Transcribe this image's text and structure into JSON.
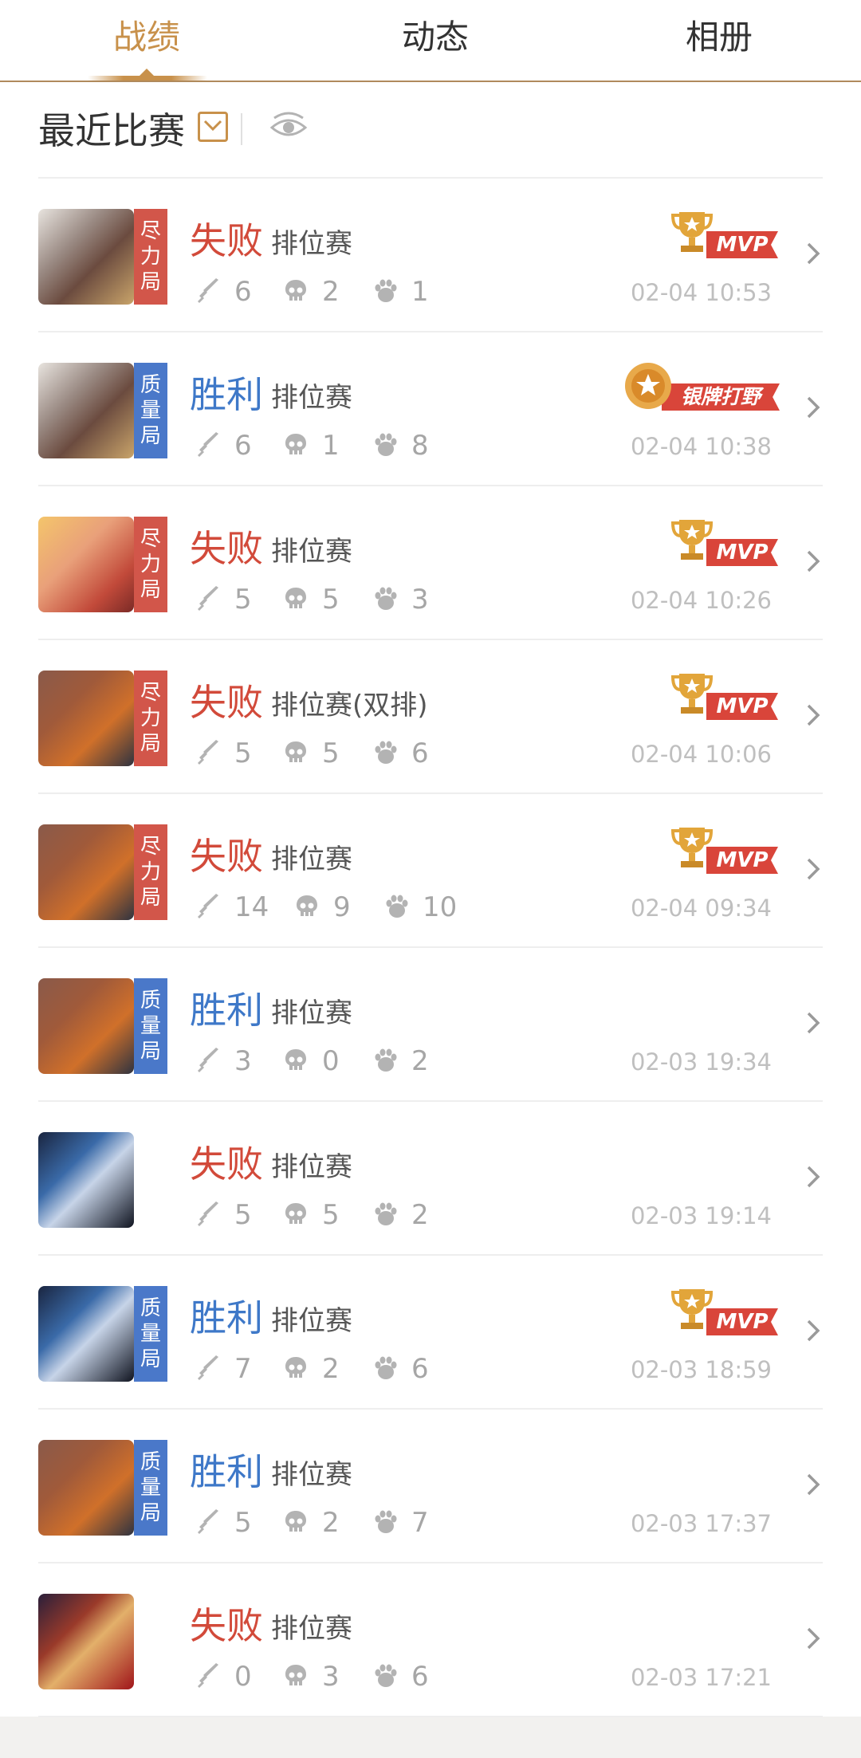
{
  "tabs": [
    "战绩",
    "动态",
    "相册"
  ],
  "filter": {
    "label": "最近比赛"
  },
  "colors": {
    "accent": "#c8914b",
    "lose": "#d24a3a",
    "win": "#3e78c8",
    "badge_red": "#d2564a",
    "badge_blue": "#4a78c9"
  },
  "matches": [
    {
      "result": "失败",
      "mode": "排位赛",
      "kills": "6",
      "deaths": "2",
      "assists": "1",
      "time": "02-04 10:53",
      "badge": "尽力局",
      "medal": "MVP",
      "avatar": "white-haired-hero"
    },
    {
      "result": "胜利",
      "mode": "排位赛",
      "kills": "6",
      "deaths": "1",
      "assists": "8",
      "time": "02-04 10:38",
      "badge": "质量局",
      "medal": "银牌打野",
      "avatar": "white-haired-hero"
    },
    {
      "result": "失败",
      "mode": "排位赛",
      "kills": "5",
      "deaths": "5",
      "assists": "3",
      "time": "02-04 10:26",
      "badge": "尽力局",
      "medal": "MVP",
      "avatar": "blonde-heroine"
    },
    {
      "result": "失败",
      "mode": "排位赛(双排)",
      "kills": "5",
      "deaths": "5",
      "assists": "6",
      "time": "02-04 10:06",
      "badge": "尽力局",
      "medal": "MVP",
      "avatar": "fire-warrior"
    },
    {
      "result": "失败",
      "mode": "排位赛",
      "kills": "14",
      "deaths": "9",
      "assists": "10",
      "time": "02-04 09:34",
      "badge": "尽力局",
      "medal": "MVP",
      "avatar": "fire-warrior"
    },
    {
      "result": "胜利",
      "mode": "排位赛",
      "kills": "3",
      "deaths": "0",
      "assists": "2",
      "time": "02-03 19:34",
      "badge": "质量局",
      "medal": "",
      "avatar": "fire-warrior"
    },
    {
      "result": "失败",
      "mode": "排位赛",
      "kills": "5",
      "deaths": "5",
      "assists": "2",
      "time": "02-03 19:14",
      "badge": "",
      "medal": "",
      "avatar": "masked-ninja"
    },
    {
      "result": "胜利",
      "mode": "排位赛",
      "kills": "7",
      "deaths": "2",
      "assists": "6",
      "time": "02-03 18:59",
      "badge": "质量局",
      "medal": "MVP",
      "avatar": "masked-ninja"
    },
    {
      "result": "胜利",
      "mode": "排位赛",
      "kills": "5",
      "deaths": "2",
      "assists": "7",
      "time": "02-03 17:37",
      "badge": "质量局",
      "medal": "",
      "avatar": "fire-warrior"
    },
    {
      "result": "失败",
      "mode": "排位赛",
      "kills": "0",
      "deaths": "3",
      "assists": "6",
      "time": "02-03 17:21",
      "badge": "",
      "medal": "",
      "avatar": "red-warrior"
    }
  ]
}
